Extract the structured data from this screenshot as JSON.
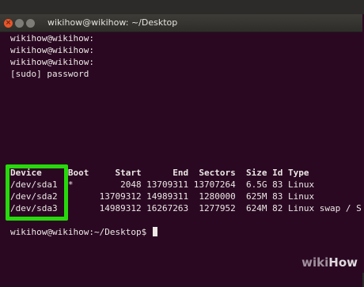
{
  "window": {
    "title": "wikihow@wikihow: ~/Desktop",
    "close_glyph": "×",
    "min_glyph": "",
    "max_glyph": ""
  },
  "terminal": {
    "prompt_lines": [
      "wikihow@wikihow:",
      "wikihow@wikihow:",
      "wikihow@wikihow:",
      "[sudo] password"
    ],
    "table_header": "Device     Boot     Start      End  Sectors  Size Id Type",
    "rows": [
      "/dev/sda1  *         2048 13709311 13707264  6.5G 83 Linux",
      "/dev/sda2        13709312 14989311  1280000  625M 83 Linux",
      "/dev/sda3        14989312 16267263  1277952  624M 82 Linux swap / S"
    ],
    "final_prompt": "wikihow@wikihow:~/Desktop$ "
  },
  "highlight_color": "#27d90c",
  "watermark": {
    "wiki": "wiki",
    "how": "How"
  }
}
